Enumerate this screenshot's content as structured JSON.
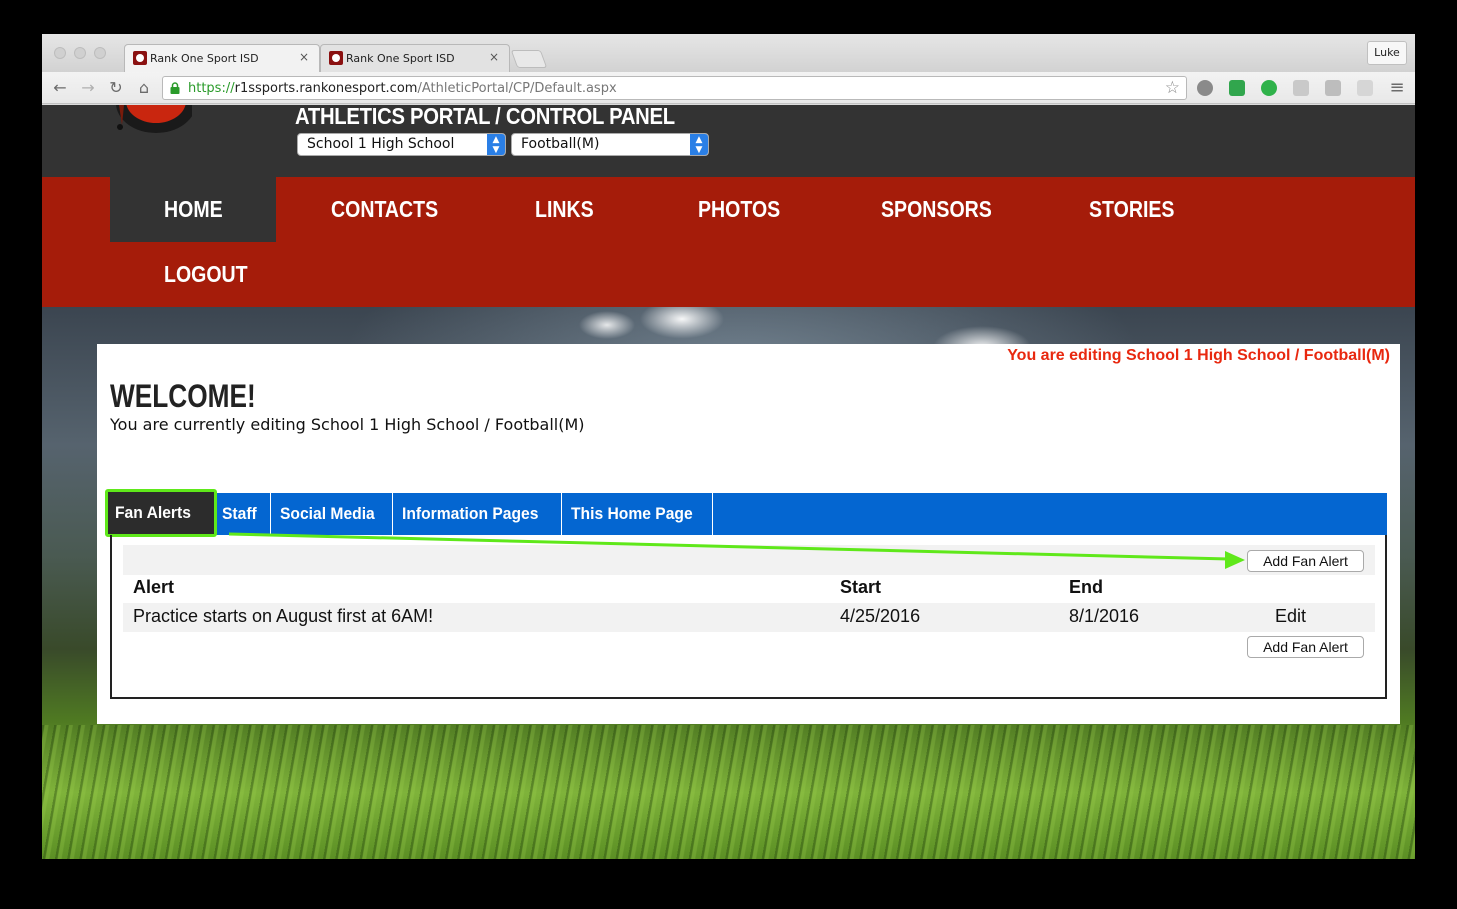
{
  "browser": {
    "tabs": [
      {
        "title": "Rank One Sport ISD",
        "close": "×"
      },
      {
        "title": "Rank One Sport ISD",
        "close": "×"
      }
    ],
    "profile": "Luke",
    "url": {
      "protocol": "https://",
      "host": "r1ssports.rankonesport.com",
      "path": "/AthleticPortal/CP/Default.aspx"
    }
  },
  "header": {
    "title": "ATHLETICS PORTAL / CONTROL PANEL",
    "school_select": "School 1 High School",
    "sport_select": "Football(M)"
  },
  "nav": {
    "items": [
      {
        "label": "HOME",
        "active": true
      },
      {
        "label": "CONTACTS"
      },
      {
        "label": "LINKS"
      },
      {
        "label": "PHOTOS"
      },
      {
        "label": "SPONSORS"
      },
      {
        "label": "STORIES"
      },
      {
        "label": "LOGOUT"
      }
    ]
  },
  "panel": {
    "editing_banner": "You are editing School 1 High School / Football(M)",
    "welcome_title": "WELCOME!",
    "welcome_sub": "You are currently editing School 1 High School / Football(M)",
    "tabs": [
      {
        "label": "Fan Alerts",
        "active": true
      },
      {
        "label": "Staff"
      },
      {
        "label": "Social Media"
      },
      {
        "label": "Information Pages"
      },
      {
        "label": "This Home Page"
      }
    ],
    "add_button_label": "Add Fan Alert",
    "table": {
      "headers": {
        "alert": "Alert",
        "start": "Start",
        "end": "End"
      },
      "rows": [
        {
          "alert": "Practice starts on August first at 6AM!",
          "start": "4/25/2016",
          "end": "8/1/2016",
          "action": "Edit"
        }
      ]
    }
  },
  "colors": {
    "nav_red": "#a51c0a",
    "tab_blue": "#0466d1",
    "highlight_green": "#5fe81a",
    "banner_red": "#e8280f"
  }
}
